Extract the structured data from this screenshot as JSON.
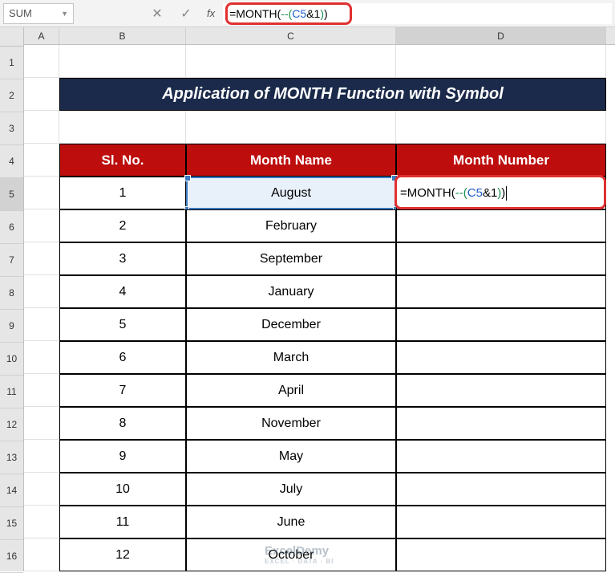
{
  "nameBox": "SUM",
  "formulaBar": {
    "parts": [
      {
        "t": "=MONTH(",
        "c": "black"
      },
      {
        "t": "--(",
        "c": "green"
      },
      {
        "t": "C5",
        "c": "blue"
      },
      {
        "t": "&1",
        "c": "black"
      },
      {
        "t": ")",
        "c": "green"
      },
      {
        "t": ")",
        "c": "black"
      }
    ]
  },
  "columns": [
    "A",
    "B",
    "C",
    "D"
  ],
  "rowNumbers": [
    "1",
    "2",
    "3",
    "4",
    "5",
    "6",
    "7",
    "8",
    "9",
    "10",
    "11",
    "12",
    "13",
    "14",
    "15",
    "16"
  ],
  "title": "Application of MONTH Function with Symbol",
  "headers": {
    "sl": "Sl. No.",
    "monthName": "Month Name",
    "monthNumber": "Month Number"
  },
  "cellFormulaParts": [
    {
      "t": "=MONTH(",
      "c": "black"
    },
    {
      "t": "--(",
      "c": "green"
    },
    {
      "t": "C5",
      "c": "blue"
    },
    {
      "t": "&1",
      "c": "black"
    },
    {
      "t": ")",
      "c": "green"
    },
    {
      "t": ")",
      "c": "black"
    }
  ],
  "dataRows": [
    {
      "sl": "1",
      "month": "August"
    },
    {
      "sl": "2",
      "month": "February"
    },
    {
      "sl": "3",
      "month": "September"
    },
    {
      "sl": "4",
      "month": "January"
    },
    {
      "sl": "5",
      "month": "December"
    },
    {
      "sl": "6",
      "month": "March"
    },
    {
      "sl": "7",
      "month": "April"
    },
    {
      "sl": "8",
      "month": "November"
    },
    {
      "sl": "9",
      "month": "May"
    },
    {
      "sl": "10",
      "month": "July"
    },
    {
      "sl": "11",
      "month": "June"
    },
    {
      "sl": "12",
      "month": "October"
    }
  ],
  "watermark": {
    "main": "ExcelDemy",
    "sub": "EXCEL · DATA · BI"
  },
  "chart_data": {
    "type": "table",
    "title": "Application of MONTH Function with Symbol",
    "columns": [
      "Sl. No.",
      "Month Name",
      "Month Number"
    ],
    "rows": [
      [
        1,
        "August",
        "=MONTH(--(C5&1))"
      ],
      [
        2,
        "February",
        ""
      ],
      [
        3,
        "September",
        ""
      ],
      [
        4,
        "January",
        ""
      ],
      [
        5,
        "December",
        ""
      ],
      [
        6,
        "March",
        ""
      ],
      [
        7,
        "April",
        ""
      ],
      [
        8,
        "November",
        ""
      ],
      [
        9,
        "May",
        ""
      ],
      [
        10,
        "July",
        ""
      ],
      [
        11,
        "June",
        ""
      ],
      [
        12,
        "October",
        ""
      ]
    ]
  }
}
